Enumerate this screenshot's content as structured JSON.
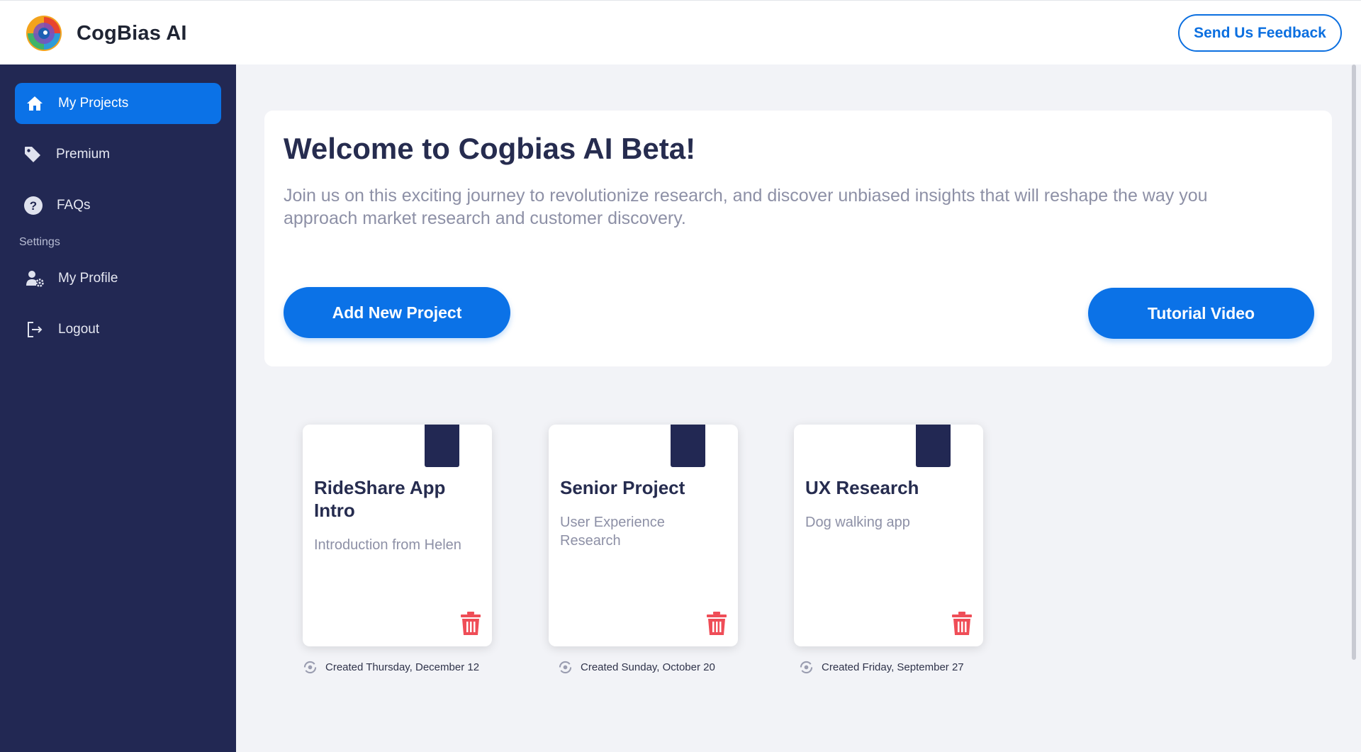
{
  "header": {
    "app_name": "CogBias AI",
    "feedback_label": "Send Us Feedback"
  },
  "sidebar": {
    "items": [
      {
        "label": "My Projects",
        "icon": "home-icon",
        "active": true
      },
      {
        "label": "Premium",
        "icon": "tag-icon",
        "active": false
      },
      {
        "label": "FAQs",
        "icon": "question-circle-icon",
        "active": false
      }
    ],
    "section_label": "Settings",
    "settings_items": [
      {
        "label": "My Profile",
        "icon": "user-gear-icon"
      },
      {
        "label": "Logout",
        "icon": "logout-icon"
      }
    ]
  },
  "welcome": {
    "title": "Welcome to Cogbias AI Beta!",
    "text": "Join us on this exciting journey to revolutionize research, and discover unbiased insights that will reshape the way you approach market research and customer discovery.",
    "add_label": "Add New Project",
    "tutorial_label": "Tutorial Video"
  },
  "projects": [
    {
      "title": "RideShare App Intro",
      "description": "Introduction from Helen",
      "created": "Created Thursday, December 12"
    },
    {
      "title": "Senior Project",
      "description": "User Experience Research",
      "created": "Created Sunday, October 20"
    },
    {
      "title": "UX Research",
      "description": "Dog walking app",
      "created": "Created Friday, September 27"
    }
  ],
  "colors": {
    "accent": "#0b72e7",
    "sidebar": "#222853",
    "delete": "#ef4d57"
  }
}
